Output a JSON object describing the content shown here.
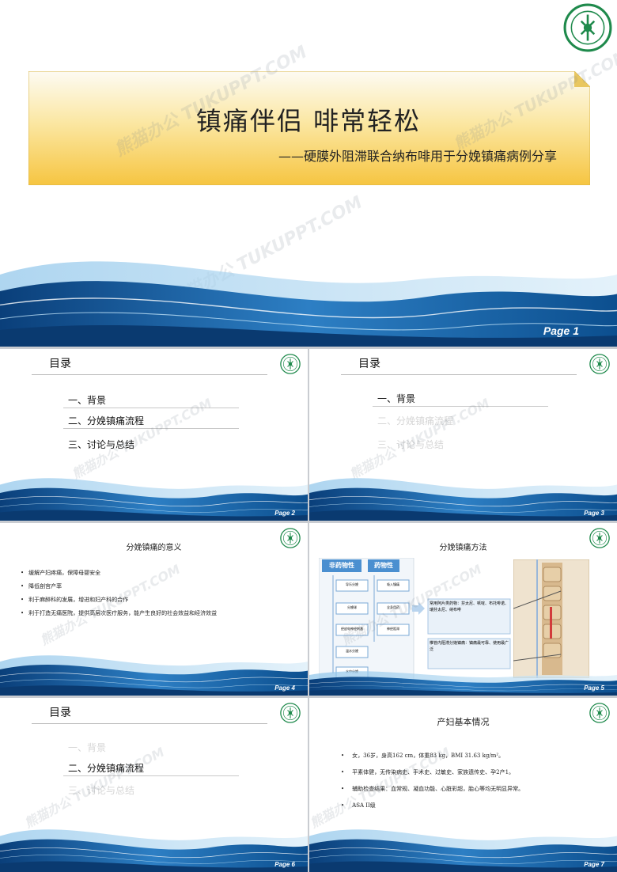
{
  "cover": {
    "title": "镇痛伴侣 啡常轻松",
    "subtitle": "——硬膜外阻滞联合纳布啡用于分娩镇痛病例分享",
    "page": "Page 1"
  },
  "toc": {
    "heading": "目录",
    "items": [
      "一、背景",
      "二、分娩镇痛流程",
      "三、讨论与总结"
    ]
  },
  "pages": {
    "p2": "Page 2",
    "p3": "Page 3",
    "p4": "Page 4",
    "p5": "Page 5",
    "p6": "Page 6",
    "p7": "Page 7"
  },
  "significance": {
    "title": "分娩镇痛的意义",
    "bullets": [
      "缓解产妇疼痛，保障母婴安全",
      "降低剖宫产率",
      "利于麻醉科的发展，增进和妇产科的合作",
      "利于打造无痛医院，提供高层次医疗服务，能产生良好的社会效益和经济效益"
    ]
  },
  "methods": {
    "title": "分娩镇痛方法",
    "non_drug_label": "非药物性",
    "drug_label": "药物性",
    "non_drug_items": [
      "导乐分娩",
      "分娩球",
      "经皮电神经刺激",
      "温水分娩",
      "水中分娩"
    ],
    "drug_items": [
      "吸入镇痛",
      "全身用药",
      "神经阻滞"
    ],
    "note1": "常用阿片类药物：芬太尼、哌啶、布托啡诺、瑞芬太尼、纳布啡",
    "note2": "椎管内阻滞分娩镇痛：镇痛最可靠、使用最广泛"
  },
  "patient": {
    "title": "产妇基本情况",
    "bullets": [
      "女，36岁，身高162 cm，体重83 kg，BMI 31.63 kg/m²。",
      "平素体健，无传染病史、手术史、过敏史、家族遗传史、孕2产1。",
      "辅助检查结果：血常规、凝血功能、心脏彩超，胎心等均无明显异常。",
      "ASA II级"
    ]
  },
  "watermark": "熊猫办公 TUKUPPT.COM",
  "colors": {
    "wave_dark": "#0b4f8c",
    "wave_light": "#5aa7dc",
    "banner": "#f7c948",
    "logo_green": "#1f8a4c",
    "method_blue": "#4a8fd0"
  },
  "icons": [
    "hospital-logo-icon",
    "spine-anatomy-image"
  ]
}
